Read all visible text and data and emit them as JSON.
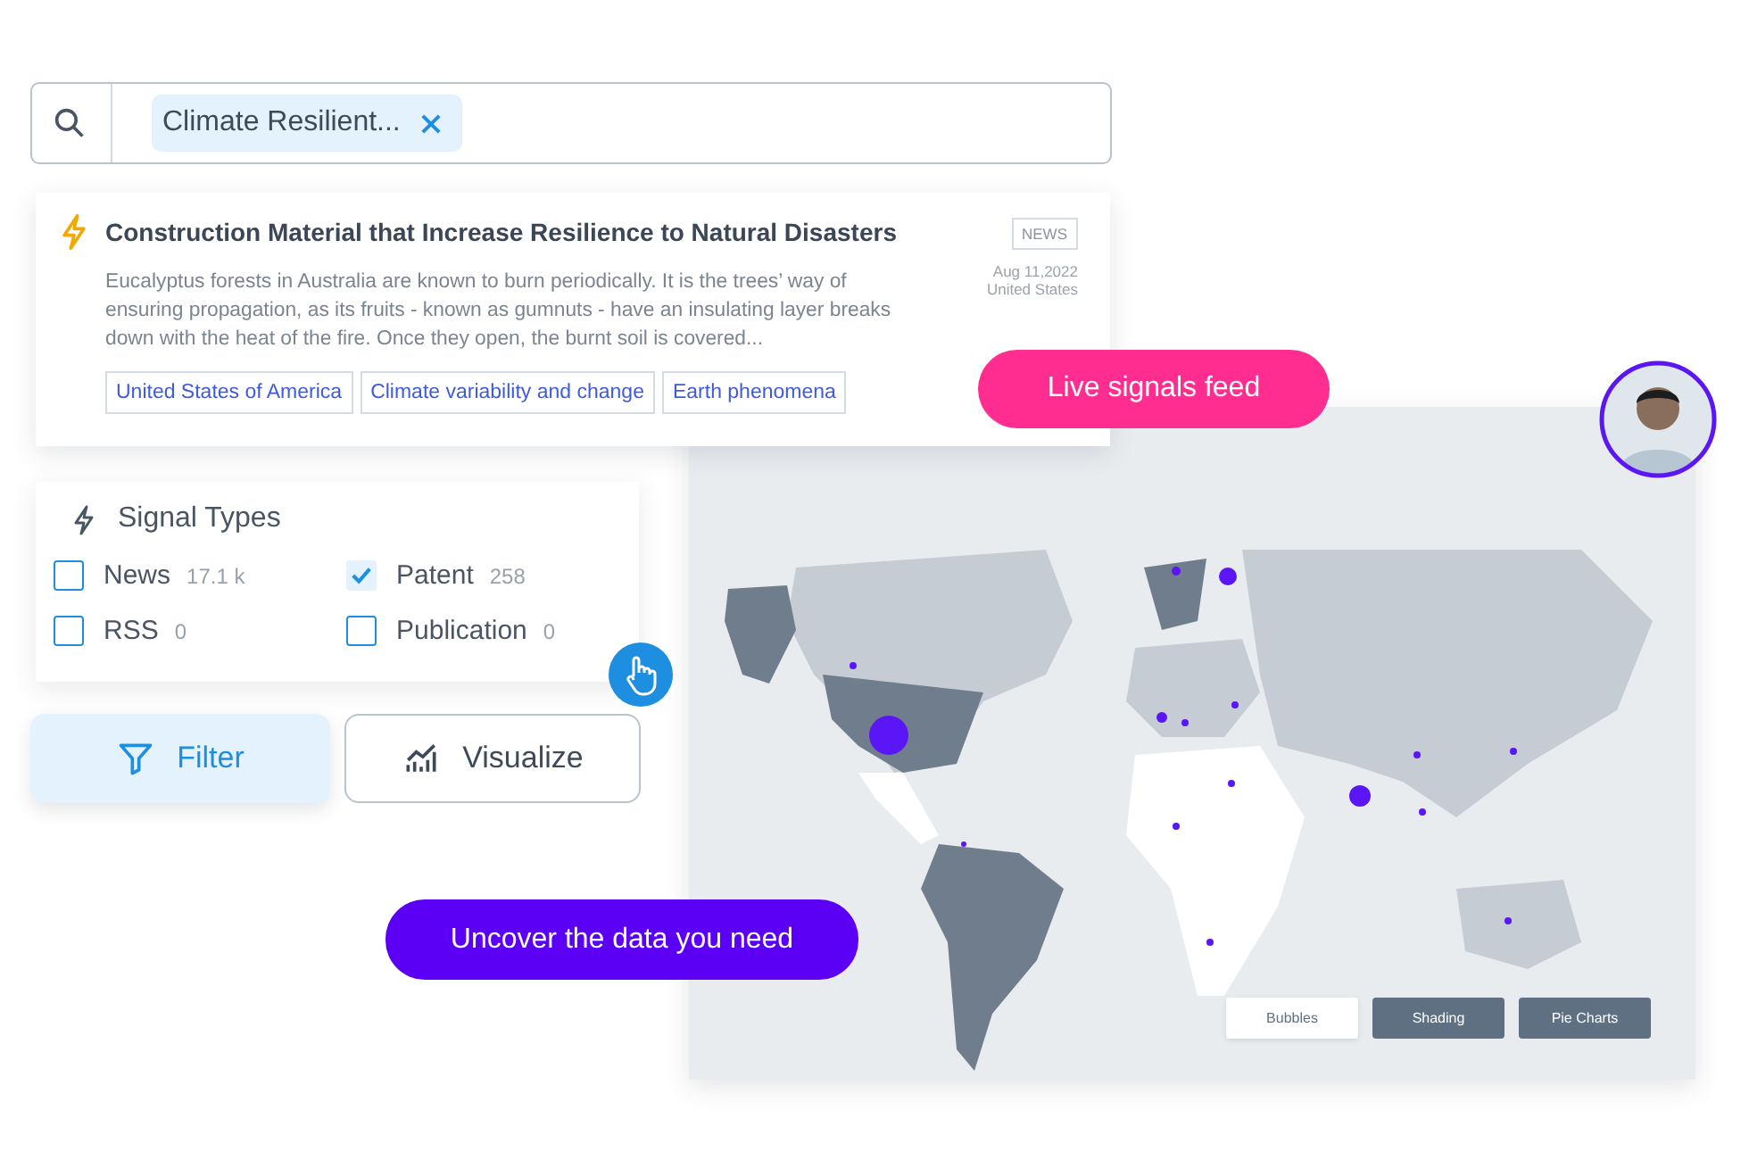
{
  "search": {
    "chip": "Climate Resilient..."
  },
  "article": {
    "title": "Construction Material that Increase Resilience to Natural Disasters",
    "summary": "Eucalyptus forests in Australia are known to burn periodically. It is the trees’ way of ensuring propagation, as its fruits - known as gumnuts - have an insulating layer breaks down with the heat of the fire. Once they open, the burnt soil is covered...",
    "badge": "NEWS",
    "date": "Aug 11,2022",
    "location": "United States",
    "tags": [
      "United States of America",
      "Climate variability and change",
      "Earth phenomena"
    ]
  },
  "signal_types": {
    "title": "Signal Types",
    "items": [
      {
        "label": "News",
        "count": "17.1 k",
        "checked": false
      },
      {
        "label": "Patent",
        "count": "258",
        "checked": true
      },
      {
        "label": "RSS",
        "count": "0",
        "checked": false
      },
      {
        "label": "Publication",
        "count": "0",
        "checked": false
      }
    ]
  },
  "actions": [
    {
      "kind": "filter",
      "label": "Filter",
      "selected": true
    },
    {
      "kind": "visualize",
      "label": "Visualize",
      "selected": false
    }
  ],
  "callouts": [
    {
      "kind": "pink",
      "text": "Live signals feed"
    },
    {
      "kind": "purple",
      "text": "Uncover the data you need"
    }
  ],
  "map": {
    "modes": [
      {
        "label": "Bubbles",
        "selected": true
      },
      {
        "label": "Shading",
        "selected": false
      },
      {
        "label": "Pie Charts",
        "selected": false
      }
    ]
  }
}
